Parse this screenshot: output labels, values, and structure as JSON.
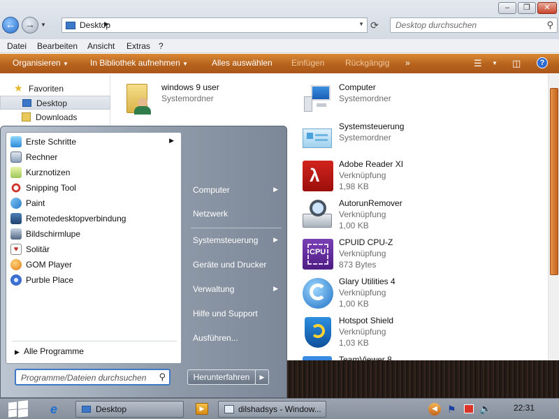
{
  "address": {
    "crumb": "Desktop"
  },
  "search": {
    "placeholder": "Desktop durchsuchen"
  },
  "menu": [
    "Datei",
    "Bearbeiten",
    "Ansicht",
    "Extras",
    "?"
  ],
  "commands": {
    "organize": "Organisieren",
    "library": "In Bibliothek aufnehmen",
    "select_all": "Alles auswählen",
    "paste": "Einfügen",
    "undo": "Rückgängig",
    "more": "»"
  },
  "nav": {
    "favorites": "Favoriten",
    "desktop": "Desktop",
    "downloads": "Downloads"
  },
  "files": [
    {
      "name": "windows 9 user",
      "type": "Systemordner",
      "size": ""
    },
    {
      "name": "Computer",
      "type": "Systemordner",
      "size": ""
    },
    {
      "name": "Systemsteuerung",
      "type": "Systemordner",
      "size": ""
    },
    {
      "name": "Adobe Reader XI",
      "type": "Verknüpfung",
      "size": "1,98 KB"
    },
    {
      "name": "AutorunRemover",
      "type": "Verknüpfung",
      "size": "1,00 KB"
    },
    {
      "name": "CPUID CPU-Z",
      "type": "Verknüpfung",
      "size": "873 Bytes"
    },
    {
      "name": "Glary Utilities 4",
      "type": "Verknüpfung",
      "size": "1,00 KB"
    },
    {
      "name": "Hotspot Shield",
      "type": "Verknüpfung",
      "size": "1,03 KB"
    },
    {
      "name": "TeamViewer 8",
      "type": "",
      "size": ""
    }
  ],
  "start_menu": {
    "programs": [
      {
        "label": "Erste Schritte",
        "arrow": "▶"
      },
      {
        "label": "Rechner",
        "arrow": ""
      },
      {
        "label": "Kurznotizen",
        "arrow": ""
      },
      {
        "label": "Snipping Tool",
        "arrow": ""
      },
      {
        "label": "Paint",
        "arrow": ""
      },
      {
        "label": "Remotedesktopverbindung",
        "arrow": ""
      },
      {
        "label": "Bildschirmlupe",
        "arrow": ""
      },
      {
        "label": "Solitär",
        "arrow": ""
      },
      {
        "label": "GOM Player",
        "arrow": ""
      },
      {
        "label": "Purble Place",
        "arrow": ""
      }
    ],
    "all_programs": "Alle Programme",
    "search_placeholder": "Programme/Dateien durchsuchen",
    "right": [
      {
        "label": "Computer",
        "arrow": "▶"
      },
      {
        "label": "Netzwerk",
        "arrow": ""
      },
      {
        "label": "Systemsteuerung",
        "arrow": "▶"
      },
      {
        "label": "Geräte und Drucker",
        "arrow": ""
      },
      {
        "label": "Verwaltung",
        "arrow": "▶"
      },
      {
        "label": "Hilfe und Support",
        "arrow": ""
      },
      {
        "label": "Ausführen...",
        "arrow": ""
      }
    ],
    "shutdown": "Herunterfahren"
  },
  "taskbar": {
    "desktop": "Desktop",
    "window": "dilshadsys - Window...",
    "clock": "22:31"
  },
  "colors": {
    "accent": "#c4641d",
    "menu_bg": "#8f9aa9"
  }
}
